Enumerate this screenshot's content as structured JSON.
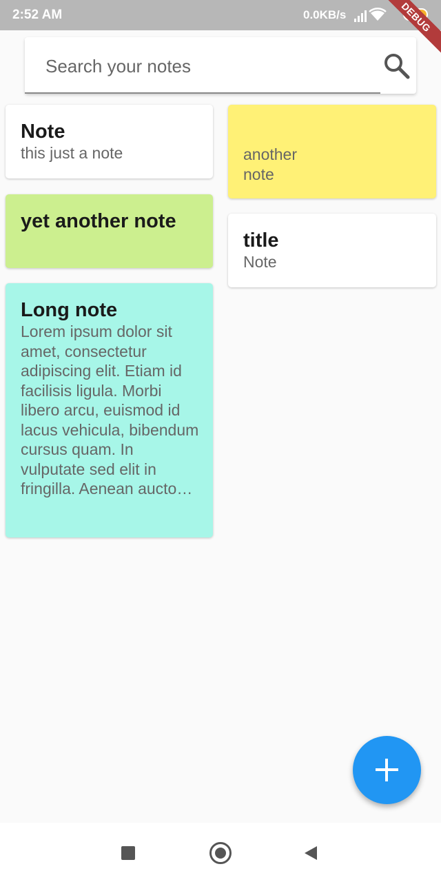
{
  "status": {
    "time": "2:52 AM",
    "network_speed": "0.0KB/s",
    "battery": "91",
    "debug_banner": "DEBUG"
  },
  "search": {
    "placeholder": "Search your notes",
    "value": ""
  },
  "notes": [
    {
      "title": "Note",
      "body": "this just a note",
      "color": "#ffffff"
    },
    {
      "title": "",
      "body": "another note",
      "color": "#fff176"
    },
    {
      "title": "yet another note",
      "body": "",
      "color": "#ccef8f"
    },
    {
      "title": "title",
      "body": "Note",
      "color": "#ffffff"
    },
    {
      "title": "Long note",
      "body": "Lorem ipsum dolor sit amet, consectetur adipiscing elit. Etiam id facilisis ligula. Morbi libero arcu, euismod id lacus vehicula, bibendum cursus quam. In vulputate sed elit in fringilla. Aenean aucto…",
      "color": "#a7f6e8"
    }
  ],
  "fab": {
    "icon": "plus-icon",
    "color": "#2196f3"
  },
  "navbar": {
    "icons": [
      "recents-square-icon",
      "home-circle-icon",
      "back-triangle-icon"
    ]
  }
}
